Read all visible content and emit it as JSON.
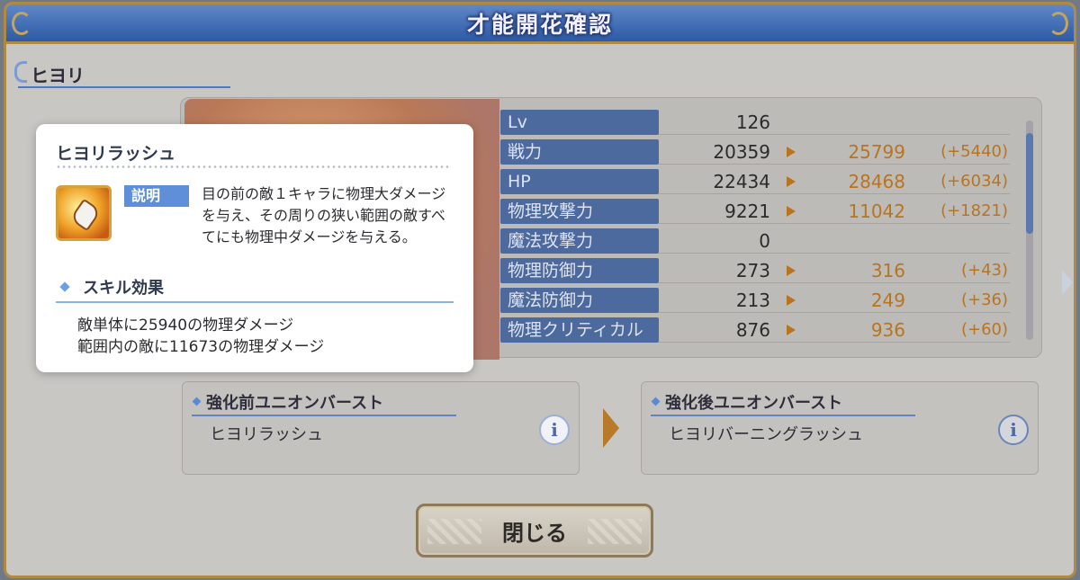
{
  "dialog": {
    "title": "才能開花確認",
    "character_name": "ヒヨリ"
  },
  "stats": [
    {
      "label": "Lv",
      "base": "126",
      "new": "",
      "diff": ""
    },
    {
      "label": "戦力",
      "base": "20359",
      "new": "25799",
      "diff": "(+5440)"
    },
    {
      "label": "HP",
      "base": "22434",
      "new": "28468",
      "diff": "(+6034)"
    },
    {
      "label": "物理攻撃力",
      "base": "9221",
      "new": "11042",
      "diff": "(+1821)"
    },
    {
      "label": "魔法攻撃力",
      "base": "0",
      "new": "",
      "diff": ""
    },
    {
      "label": "物理防御力",
      "base": "273",
      "new": "316",
      "diff": "(+43)"
    },
    {
      "label": "魔法防御力",
      "base": "213",
      "new": "249",
      "diff": "(+36)"
    },
    {
      "label": "物理クリティカル",
      "base": "876",
      "new": "936",
      "diff": "(+60)"
    }
  ],
  "union_burst": {
    "before_title": "強化前ユニオンバースト",
    "before_skill": "ヒヨリラッシュ",
    "after_title": "強化後ユニオンバースト",
    "after_skill": "ヒヨリバーニングラッシュ",
    "info_icon_glyph": "i"
  },
  "close_button": "閉じる",
  "popup": {
    "title": "ヒヨリラッシュ",
    "desc_tag": "説明",
    "description": "目の前の敵１キャラに物理大ダメージを与え、その周りの狭い範囲の敵すべてにも物理中ダメージを与える。",
    "effect_heading": "スキル効果",
    "effect_line1": "敵単体に25940の物理ダメージ",
    "effect_line2": "範囲内の敵に11673の物理ダメージ"
  },
  "colors": {
    "title_bar": "#2d5aa6",
    "stat_label_bg": "#4d6a9f",
    "accent_orange": "#b8741f",
    "frame_gold": "#b08a45"
  }
}
